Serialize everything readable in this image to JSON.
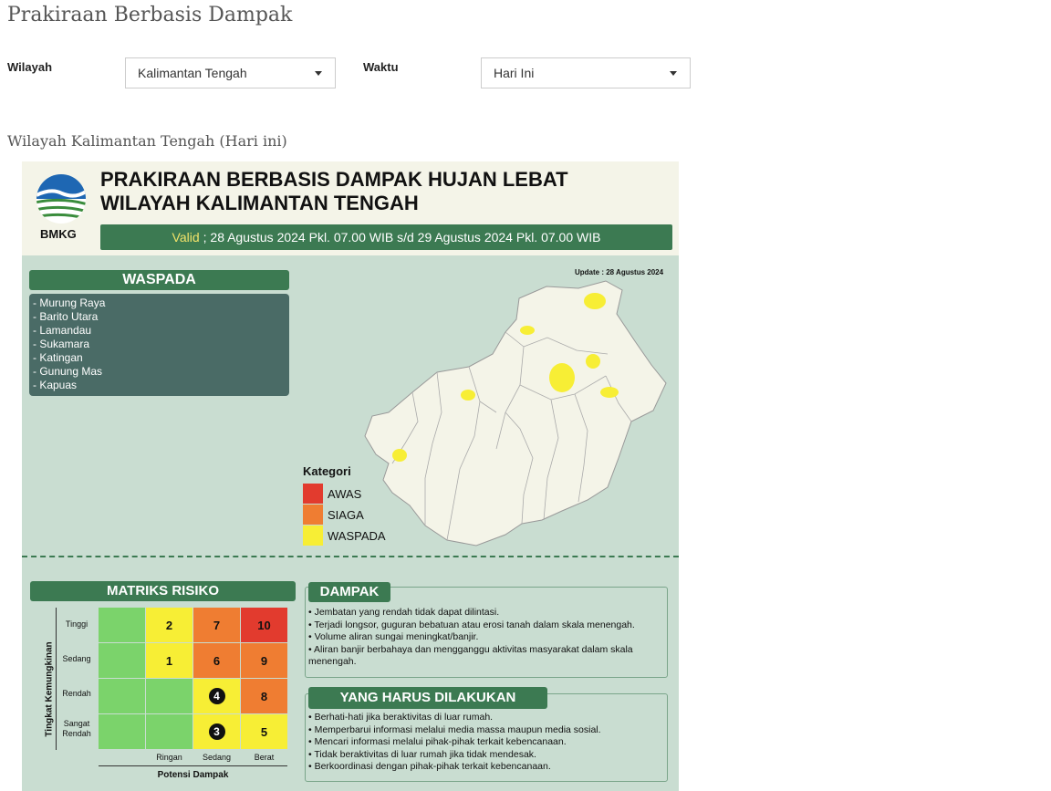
{
  "page": {
    "title": "Prakiraan Berbasis Dampak"
  },
  "filters": {
    "region_label": "Wilayah",
    "region_value": "Kalimantan Tengah",
    "time_label": "Waktu",
    "time_value": "Hari Ini"
  },
  "subtitle": "Wilayah Kalimantan Tengah (Hari ini)",
  "infographic": {
    "logo_text": "BMKG",
    "title_line1": "PRAKIRAAN BERBASIS DAMPAK HUJAN LEBAT",
    "title_line2": "WILAYAH KALIMANTAN TENGAH",
    "valid_label": "Valid",
    "valid_range": "; 28 Agustus 2024 Pkl. 07.00 WIB s/d 29 Agustus 2024 Pkl. 07.00 WIB",
    "update": "Update : 28 Agustus 2024",
    "waspada_title": "WASPADA",
    "waspada_areas": [
      "- Murung Raya",
      "- Barito Utara",
      "- Lamandau",
      "- Sukamara",
      "- Katingan",
      "- Gunung Mas",
      "- Kapuas"
    ],
    "legend_title": "Kategori",
    "legend": [
      {
        "label": "AWAS",
        "color": "#e23b2e"
      },
      {
        "label": "SIAGA",
        "color": "#ef7d32"
      },
      {
        "label": "WASPADA",
        "color": "#f7ee35"
      }
    ],
    "matrix": {
      "title": "MATRIKS RISIKO",
      "y_title": "Tingkat Kemungkinan",
      "x_title": "Potensi Dampak",
      "rows": [
        "Tinggi",
        "Sedang",
        "Rendah",
        "Sangat Rendah"
      ],
      "cols": [
        "Ringan",
        "Sedang",
        "Berat"
      ],
      "cells": [
        [
          "",
          "2",
          "7",
          "10"
        ],
        [
          "",
          "1",
          "6",
          "9"
        ],
        [
          "",
          "",
          "4",
          "8"
        ],
        [
          "",
          "",
          "3",
          "5"
        ]
      ],
      "highlighted": [
        "4",
        "3"
      ]
    },
    "dampak": {
      "title": "DAMPAK",
      "items": [
        "Jembatan yang rendah tidak dapat dilintasi.",
        "Terjadi longsor, guguran bebatuan atau erosi tanah dalam skala menengah.",
        "Volume aliran sungai meningkat/banjir.",
        "Aliran banjir berbahaya dan mengganggu aktivitas masyarakat dalam skala menengah."
      ]
    },
    "todo": {
      "title": "YANG HARUS DILAKUKAN",
      "items": [
        "Berhati-hati jika beraktivitas di luar rumah.",
        "Memperbarui informasi melalui media massa maupun media sosial.",
        "Mencari informasi melalui pihak-pihak terkait kebencanaan.",
        "Tidak beraktivitas di luar rumah jika tidak mendesak.",
        "Berkoordinasi dengan pihak-pihak terkait kebencanaan."
      ]
    }
  }
}
